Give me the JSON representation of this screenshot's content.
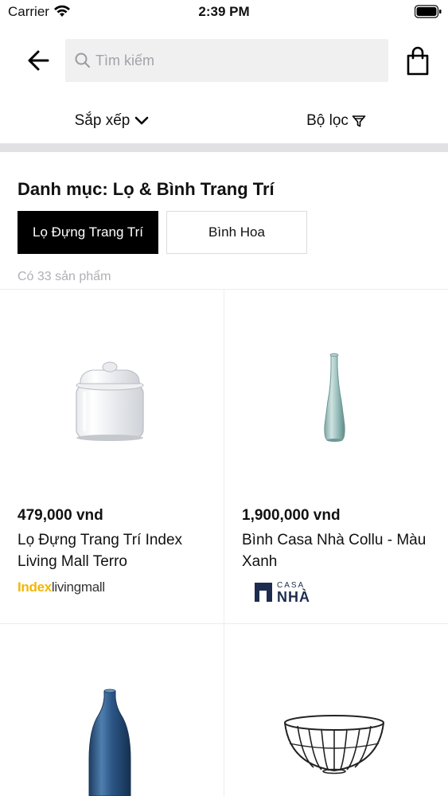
{
  "status_bar": {
    "carrier": "Carrier",
    "time": "2:39 PM"
  },
  "header": {
    "back_icon": "arrow-left-icon",
    "search_placeholder": "Tìm kiếm",
    "search_value": "",
    "cart_icon": "shopping-bag-icon"
  },
  "toolbar": {
    "sort_label": "Sắp xếp",
    "filter_label": "Bộ lọc"
  },
  "category": {
    "title": "Danh mục: Lọ & Bình Trang Trí",
    "subcategories": [
      {
        "label": "Lọ Đựng Trang Trí",
        "selected": true
      },
      {
        "label": "Bình Hoa",
        "selected": false
      }
    ],
    "count_text": "Có 33 sản phẩm"
  },
  "products": [
    {
      "price": "479,000 vnd",
      "name": "Lọ Đựng Trang Trí Index Living Mall Terro",
      "brand_logo": {
        "prefix": "Index",
        "suffix": "livingmall"
      }
    },
    {
      "price": "1,900,000 vnd",
      "name": "Bình Casa Nhà Collu - Màu Xanh",
      "brand_logo": {
        "top": "CASA",
        "bottom": "NHÀ"
      }
    },
    {
      "price": "",
      "name": "",
      "brand_logo": null
    },
    {
      "price": "",
      "name": "",
      "brand_logo": null
    }
  ],
  "colors": {
    "brand_index_yellow": "#f2b705",
    "casa_nha_navy": "#1d2b4f",
    "divider_band": "#e1e1e4",
    "search_bg": "#f0f0f1",
    "placeholder": "#a3a3a8"
  }
}
